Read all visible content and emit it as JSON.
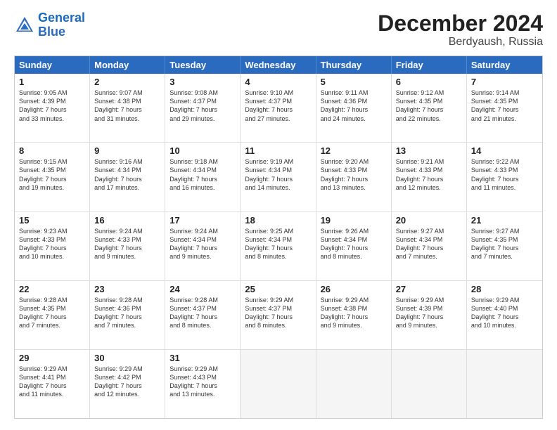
{
  "header": {
    "logo_general": "General",
    "logo_blue": "Blue",
    "title": "December 2024",
    "subtitle": "Berdyaush, Russia"
  },
  "days_of_week": [
    "Sunday",
    "Monday",
    "Tuesday",
    "Wednesday",
    "Thursday",
    "Friday",
    "Saturday"
  ],
  "weeks": [
    [
      {
        "day": 1,
        "lines": [
          "Sunrise: 9:05 AM",
          "Sunset: 4:39 PM",
          "Daylight: 7 hours",
          "and 33 minutes."
        ]
      },
      {
        "day": 2,
        "lines": [
          "Sunrise: 9:07 AM",
          "Sunset: 4:38 PM",
          "Daylight: 7 hours",
          "and 31 minutes."
        ]
      },
      {
        "day": 3,
        "lines": [
          "Sunrise: 9:08 AM",
          "Sunset: 4:37 PM",
          "Daylight: 7 hours",
          "and 29 minutes."
        ]
      },
      {
        "day": 4,
        "lines": [
          "Sunrise: 9:10 AM",
          "Sunset: 4:37 PM",
          "Daylight: 7 hours",
          "and 27 minutes."
        ]
      },
      {
        "day": 5,
        "lines": [
          "Sunrise: 9:11 AM",
          "Sunset: 4:36 PM",
          "Daylight: 7 hours",
          "and 24 minutes."
        ]
      },
      {
        "day": 6,
        "lines": [
          "Sunrise: 9:12 AM",
          "Sunset: 4:35 PM",
          "Daylight: 7 hours",
          "and 22 minutes."
        ]
      },
      {
        "day": 7,
        "lines": [
          "Sunrise: 9:14 AM",
          "Sunset: 4:35 PM",
          "Daylight: 7 hours",
          "and 21 minutes."
        ]
      }
    ],
    [
      {
        "day": 8,
        "lines": [
          "Sunrise: 9:15 AM",
          "Sunset: 4:35 PM",
          "Daylight: 7 hours",
          "and 19 minutes."
        ]
      },
      {
        "day": 9,
        "lines": [
          "Sunrise: 9:16 AM",
          "Sunset: 4:34 PM",
          "Daylight: 7 hours",
          "and 17 minutes."
        ]
      },
      {
        "day": 10,
        "lines": [
          "Sunrise: 9:18 AM",
          "Sunset: 4:34 PM",
          "Daylight: 7 hours",
          "and 16 minutes."
        ]
      },
      {
        "day": 11,
        "lines": [
          "Sunrise: 9:19 AM",
          "Sunset: 4:34 PM",
          "Daylight: 7 hours",
          "and 14 minutes."
        ]
      },
      {
        "day": 12,
        "lines": [
          "Sunrise: 9:20 AM",
          "Sunset: 4:33 PM",
          "Daylight: 7 hours",
          "and 13 minutes."
        ]
      },
      {
        "day": 13,
        "lines": [
          "Sunrise: 9:21 AM",
          "Sunset: 4:33 PM",
          "Daylight: 7 hours",
          "and 12 minutes."
        ]
      },
      {
        "day": 14,
        "lines": [
          "Sunrise: 9:22 AM",
          "Sunset: 4:33 PM",
          "Daylight: 7 hours",
          "and 11 minutes."
        ]
      }
    ],
    [
      {
        "day": 15,
        "lines": [
          "Sunrise: 9:23 AM",
          "Sunset: 4:33 PM",
          "Daylight: 7 hours",
          "and 10 minutes."
        ]
      },
      {
        "day": 16,
        "lines": [
          "Sunrise: 9:24 AM",
          "Sunset: 4:33 PM",
          "Daylight: 7 hours",
          "and 9 minutes."
        ]
      },
      {
        "day": 17,
        "lines": [
          "Sunrise: 9:24 AM",
          "Sunset: 4:34 PM",
          "Daylight: 7 hours",
          "and 9 minutes."
        ]
      },
      {
        "day": 18,
        "lines": [
          "Sunrise: 9:25 AM",
          "Sunset: 4:34 PM",
          "Daylight: 7 hours",
          "and 8 minutes."
        ]
      },
      {
        "day": 19,
        "lines": [
          "Sunrise: 9:26 AM",
          "Sunset: 4:34 PM",
          "Daylight: 7 hours",
          "and 8 minutes."
        ]
      },
      {
        "day": 20,
        "lines": [
          "Sunrise: 9:27 AM",
          "Sunset: 4:34 PM",
          "Daylight: 7 hours",
          "and 7 minutes."
        ]
      },
      {
        "day": 21,
        "lines": [
          "Sunrise: 9:27 AM",
          "Sunset: 4:35 PM",
          "Daylight: 7 hours",
          "and 7 minutes."
        ]
      }
    ],
    [
      {
        "day": 22,
        "lines": [
          "Sunrise: 9:28 AM",
          "Sunset: 4:35 PM",
          "Daylight: 7 hours",
          "and 7 minutes."
        ]
      },
      {
        "day": 23,
        "lines": [
          "Sunrise: 9:28 AM",
          "Sunset: 4:36 PM",
          "Daylight: 7 hours",
          "and 7 minutes."
        ]
      },
      {
        "day": 24,
        "lines": [
          "Sunrise: 9:28 AM",
          "Sunset: 4:37 PM",
          "Daylight: 7 hours",
          "and 8 minutes."
        ]
      },
      {
        "day": 25,
        "lines": [
          "Sunrise: 9:29 AM",
          "Sunset: 4:37 PM",
          "Daylight: 7 hours",
          "and 8 minutes."
        ]
      },
      {
        "day": 26,
        "lines": [
          "Sunrise: 9:29 AM",
          "Sunset: 4:38 PM",
          "Daylight: 7 hours",
          "and 9 minutes."
        ]
      },
      {
        "day": 27,
        "lines": [
          "Sunrise: 9:29 AM",
          "Sunset: 4:39 PM",
          "Daylight: 7 hours",
          "and 9 minutes."
        ]
      },
      {
        "day": 28,
        "lines": [
          "Sunrise: 9:29 AM",
          "Sunset: 4:40 PM",
          "Daylight: 7 hours",
          "and 10 minutes."
        ]
      }
    ],
    [
      {
        "day": 29,
        "lines": [
          "Sunrise: 9:29 AM",
          "Sunset: 4:41 PM",
          "Daylight: 7 hours",
          "and 11 minutes."
        ]
      },
      {
        "day": 30,
        "lines": [
          "Sunrise: 9:29 AM",
          "Sunset: 4:42 PM",
          "Daylight: 7 hours",
          "and 12 minutes."
        ]
      },
      {
        "day": 31,
        "lines": [
          "Sunrise: 9:29 AM",
          "Sunset: 4:43 PM",
          "Daylight: 7 hours",
          "and 13 minutes."
        ]
      },
      null,
      null,
      null,
      null
    ]
  ]
}
